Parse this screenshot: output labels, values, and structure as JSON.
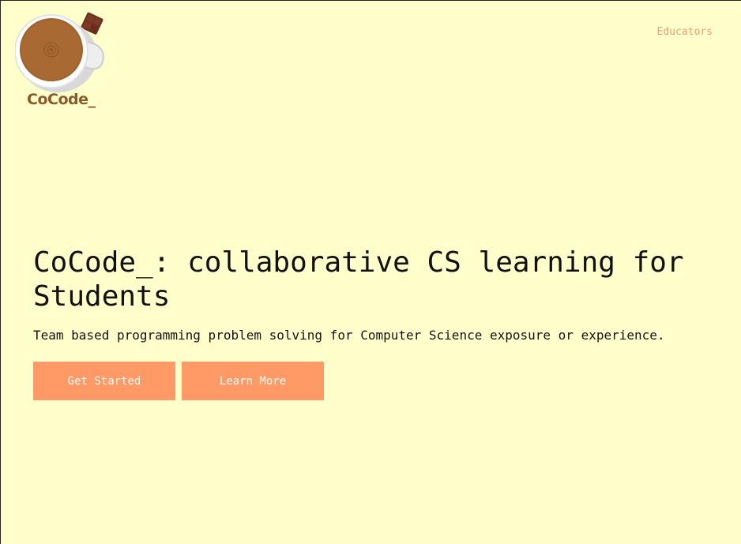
{
  "brand": {
    "logo_text": "CoCode_",
    "colors": {
      "background": "#ffffcc",
      "accent": "#ff9966",
      "coffee": "#a0622c",
      "chocolate": "#6b2e1e"
    }
  },
  "nav": {
    "educators_label": "Educators"
  },
  "hero": {
    "title": "CoCode_: collaborative CS learning for Students",
    "subtitle": "Team based programming problem solving for Computer Science exposure or experience.",
    "get_started_label": "Get Started",
    "learn_more_label": "Learn More"
  }
}
